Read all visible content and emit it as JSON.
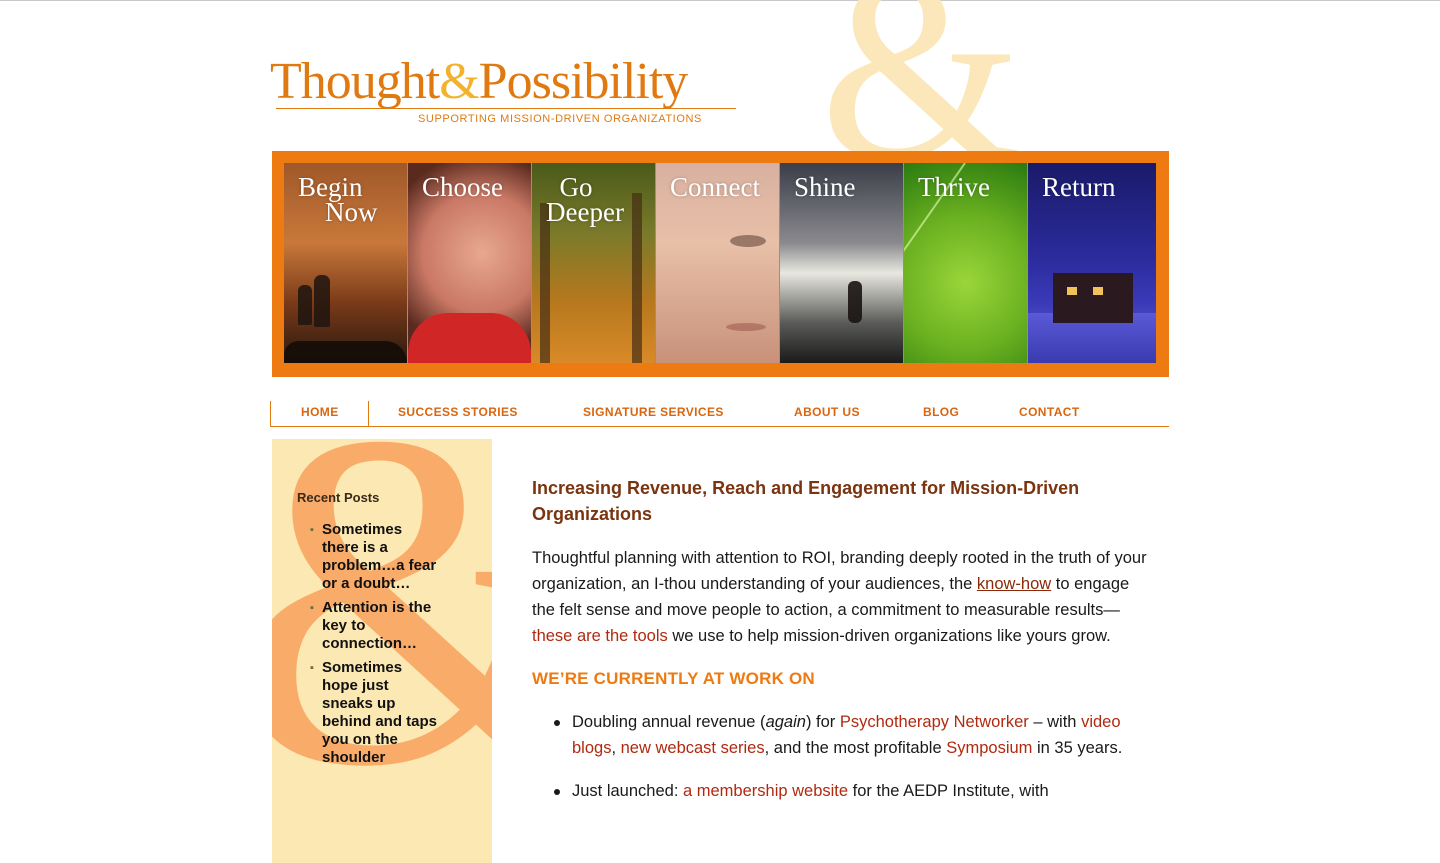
{
  "logo": {
    "title_left": "Thought",
    "ampersand": "&",
    "title_right": "Possibility",
    "tagline": "SUPPORTING MISSION-DRIVEN ORGANIZATIONS"
  },
  "decor": {
    "ampersand": "&"
  },
  "banner": {
    "panels": [
      {
        "label": "Begin\n    Now"
      },
      {
        "label": "Choose"
      },
      {
        "label": "  Go\nDeeper"
      },
      {
        "label": "Connect"
      },
      {
        "label": "Shine"
      },
      {
        "label": "Thrive"
      },
      {
        "label": "Return"
      }
    ]
  },
  "nav": {
    "items": [
      {
        "label": "HOME"
      },
      {
        "label": "SUCCESS STORIES"
      },
      {
        "label": "SIGNATURE SERVICES"
      },
      {
        "label": "ABOUT US"
      },
      {
        "label": "BLOG"
      },
      {
        "label": "CONTACT"
      }
    ]
  },
  "sidebar": {
    "title": "Recent Posts",
    "posts": [
      {
        "title": "Sometimes there is a problem…a fear or a doubt…"
      },
      {
        "title": "Attention is the key to connection…"
      },
      {
        "title": "Sometimes hope just sneaks up behind and taps you on the shoulder"
      }
    ]
  },
  "main": {
    "heading": "Increasing Revenue, Reach and Engagement for Mission-Driven Organizations",
    "intro": {
      "part1": "Thoughtful planning with attention to ROI, branding deeply rooted in the truth of your organization, an I-thou understanding of your audiences, the ",
      "link1": "know-how",
      "part2": " to engage the felt sense and move people to action, a commitment to measurable results—",
      "link2": "these are the tools",
      "part3": " we use to help mission-driven organizations like yours grow."
    },
    "work_heading": "WE’RE CURRENTLY AT WORK ON",
    "work_items": [
      {
        "t1": "Doubling annual revenue (",
        "em": "again",
        "t2": ") for ",
        "l1": "Psychotherapy Networker",
        "t3": " – with ",
        "l2": "video blogs",
        "t4": ", ",
        "l3": "new webcast series",
        "t5": ", and the most profitable ",
        "l4": "Symposium",
        "t6": " in 35 years."
      },
      {
        "t1": "Just launched: ",
        "l1": "a membership website",
        "t2": " for the AEDP Institute, with"
      }
    ]
  },
  "colors": {
    "brand_orange": "#ee7a12",
    "heading_brown": "#7a3410",
    "link_red": "#b02a10",
    "sidebar_bg": "#fce8b2"
  }
}
